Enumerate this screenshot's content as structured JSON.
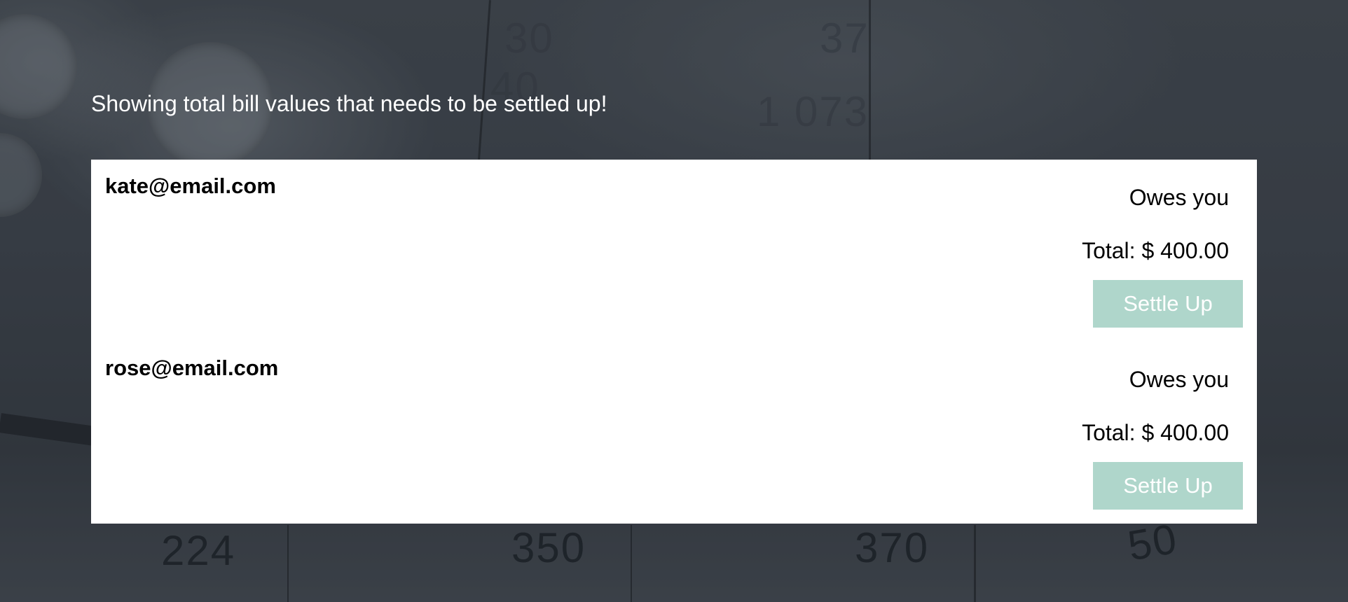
{
  "page": {
    "heading": "Showing total bill values that needs to be settled up!"
  },
  "entries": [
    {
      "email": "kate@email.com",
      "status": "Owes you",
      "total": "Total: $ 400.00",
      "button_label": "Settle Up"
    },
    {
      "email": "rose@email.com",
      "status": "Owes you",
      "total": "Total: $ 400.00",
      "button_label": "Settle Up"
    }
  ],
  "colors": {
    "button_bg": "#afd6cb",
    "panel_bg": "#ffffff",
    "heading_text": "#ffffff"
  }
}
